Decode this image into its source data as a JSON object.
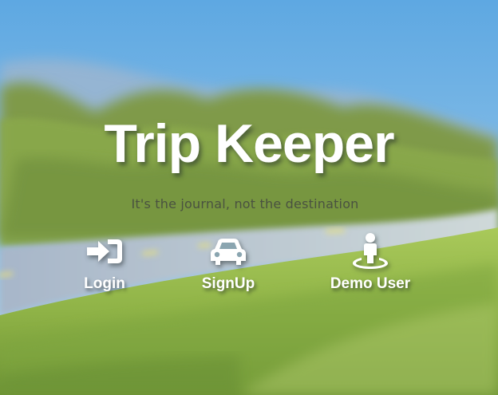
{
  "brand": {
    "title": "Trip Keeper",
    "tagline": "It's the journal, not the destination"
  },
  "actions": [
    {
      "label": "Login",
      "icon": "sign-in-icon"
    },
    {
      "label": "SignUp",
      "icon": "car-icon"
    },
    {
      "label": "Demo User",
      "icon": "street-view-icon"
    }
  ],
  "colors": {
    "sky": "#6aaee0",
    "grass": "#93b64a",
    "text": "#ffffff",
    "tagline": "#4a5240"
  }
}
